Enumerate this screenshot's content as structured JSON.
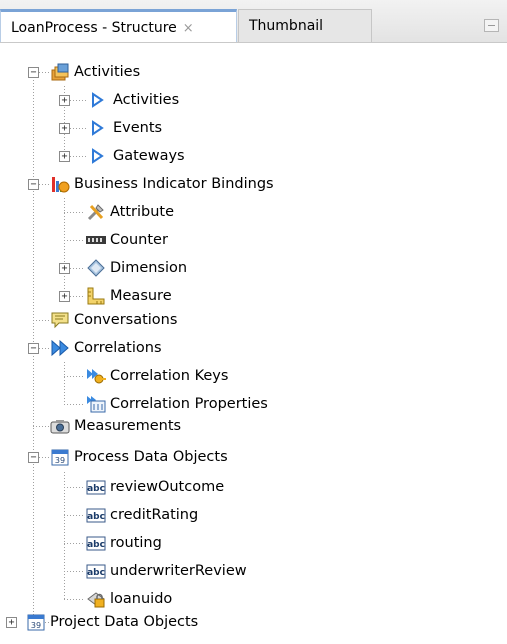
{
  "tabs": [
    {
      "label": "LoanProcess - Structure",
      "close": "×",
      "active": true
    },
    {
      "label": "Thumbnail",
      "active": false
    }
  ],
  "tree": {
    "activities": {
      "label": "Activities",
      "children": [
        "Activities",
        "Events",
        "Gateways"
      ]
    },
    "business_indicator_bindings": {
      "label": "Business Indicator Bindings",
      "children": [
        "Attribute",
        "Counter",
        "Dimension",
        "Measure"
      ]
    },
    "conversations": {
      "label": "Conversations"
    },
    "correlations": {
      "label": "Correlations",
      "children": [
        "Correlation Keys",
        "Correlation Properties"
      ]
    },
    "measurements": {
      "label": "Measurements"
    },
    "process_data_objects": {
      "label": "Process Data Objects",
      "children": [
        "reviewOutcome",
        "creditRating",
        "routing",
        "underwriterReview",
        "loanuido"
      ]
    },
    "project_data_objects": {
      "label": "Project Data Objects"
    }
  },
  "icons": {
    "abc_badge_text": "abc",
    "accent": "#7aa3d6"
  }
}
